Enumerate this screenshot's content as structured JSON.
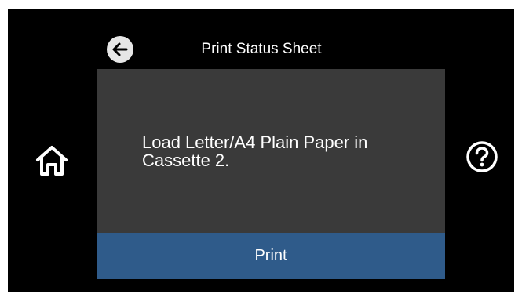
{
  "header": {
    "title": "Print Status Sheet",
    "back_icon": "arrow-left-icon"
  },
  "dialog": {
    "message": "Load Letter/A4 Plain Paper in Cassette 2.",
    "print_label": "Print"
  },
  "nav": {
    "home_icon": "home-icon",
    "help_icon": "help-icon"
  },
  "colors": {
    "background": "#000000",
    "dialog": "#3a3a3a",
    "accent": "#2f5b8a",
    "text": "#ffffff"
  }
}
